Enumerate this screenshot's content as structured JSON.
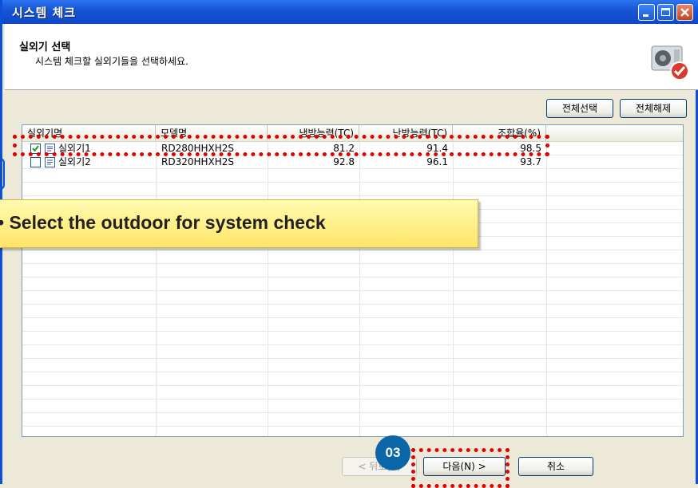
{
  "window": {
    "title": "시스템 체크",
    "controls": [
      "minimize-icon",
      "maximize-icon",
      "close-icon"
    ]
  },
  "header": {
    "title": "실외기 선택",
    "subtitle": "시스템 체크할 실외기들을 선택하세요."
  },
  "toolbar": {
    "select_all_label": "전체선택",
    "deselect_all_label": "전체해제"
  },
  "table": {
    "columns": [
      "실외기명",
      "모델명",
      "냉방능력(TC)",
      "난방능력(TC)",
      "조합율(%)"
    ],
    "rows": [
      {
        "checked": true,
        "name": "실외기1",
        "model": "RD280HHXH2S",
        "cooling": "81.2",
        "heating": "91.4",
        "ratio": "98.5"
      },
      {
        "checked": false,
        "name": "실외기2",
        "model": "RD320HHXH2S",
        "cooling": "92.8",
        "heating": "96.1",
        "ratio": "93.7"
      }
    ]
  },
  "footer": {
    "back_label": "< 뒤로(B)",
    "next_label": "다음(N) >",
    "cancel_label": "취소"
  },
  "annotations": {
    "callout_text": "• Select the outdoor for system check",
    "step_badge": "03",
    "highlight_color": "#E30000",
    "badge_color": "#0B66A7"
  }
}
